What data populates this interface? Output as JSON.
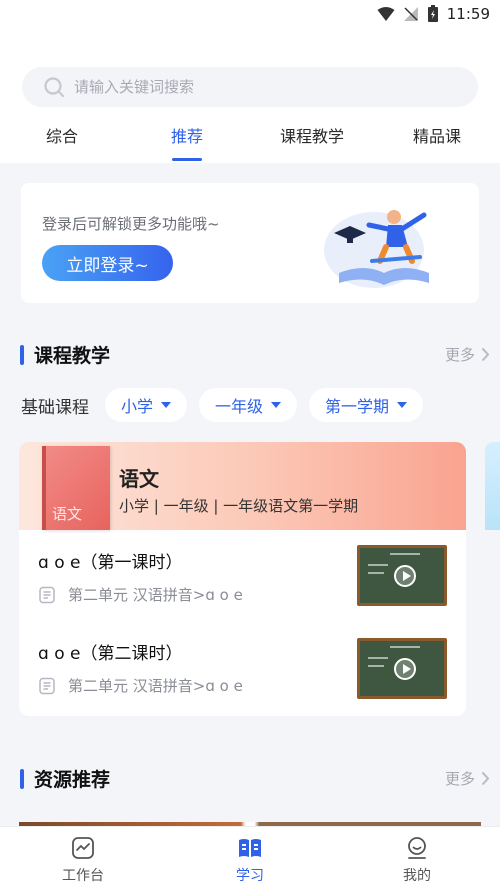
{
  "status_bar": {
    "time": "11:59"
  },
  "search": {
    "placeholder": "请输入关键词搜索"
  },
  "tabs": [
    {
      "label": "综合",
      "active": false
    },
    {
      "label": "推荐",
      "active": true
    },
    {
      "label": "课程教学",
      "active": false
    },
    {
      "label": "精品课",
      "active": false
    }
  ],
  "login_card": {
    "text": "登录后可解锁更多功能哦~",
    "button": "立即登录~"
  },
  "course_section": {
    "title": "课程教学",
    "more": "更多"
  },
  "filters": {
    "label": "基础课程",
    "options": [
      "小学",
      "一年级",
      "第一学期"
    ]
  },
  "course": {
    "subject": "语文",
    "book_cover_text": "语文",
    "meta": "小学 | 一年级 | 一年级语文第一学期",
    "lessons": [
      {
        "title": "ɑ o e（第一课时）",
        "subtitle": "第二单元 汉语拼音>ɑ o e"
      },
      {
        "title": "ɑ o e（第二课时）",
        "subtitle": "第二单元 汉语拼音>ɑ o e"
      }
    ]
  },
  "resource_section": {
    "title": "资源推荐",
    "more": "更多"
  },
  "bottom_nav": [
    {
      "label": "工作台",
      "icon": "dashboard-icon",
      "active": false
    },
    {
      "label": "学习",
      "icon": "book-icon",
      "active": true
    },
    {
      "label": "我的",
      "icon": "profile-icon",
      "active": false
    }
  ],
  "colors": {
    "accent": "#2f62e8",
    "background": "#f4f5f9"
  }
}
